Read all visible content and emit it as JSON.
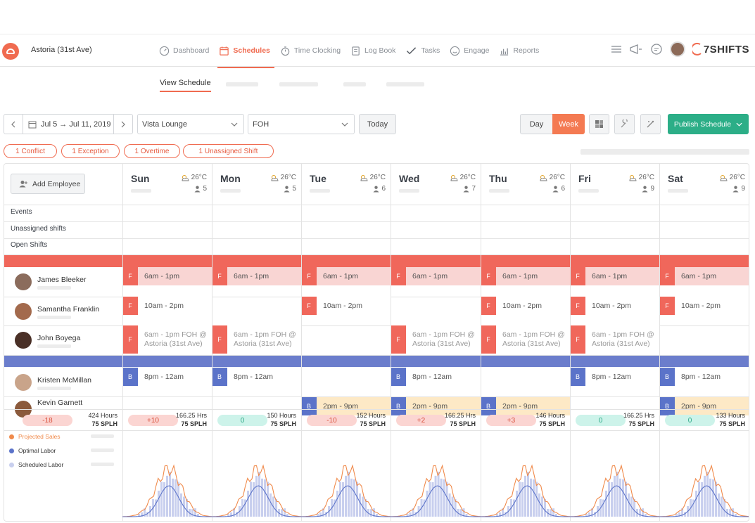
{
  "location": "Astoria (31st Ave)",
  "nav": [
    "Dashboard",
    "Schedules",
    "Time Clocking",
    "Log Book",
    "Tasks",
    "Engage",
    "Reports"
  ],
  "brand": "7SHIFTS",
  "subnav": {
    "view": "View Schedule"
  },
  "toolbar": {
    "date_range": "Jul 5 → Jul 11, 2019",
    "location_select": "Vista Lounge",
    "dept_select": "FOH",
    "today": "Today",
    "day": "Day",
    "week": "Week",
    "publish": "Publish Schedule"
  },
  "badges": [
    "1 Conflict",
    "1 Exception",
    "1 Overtime",
    "1 Unassigned Shift"
  ],
  "add_employee": "Add Employee",
  "days": [
    {
      "name": "Sun",
      "temp": "26°C",
      "count": "5"
    },
    {
      "name": "Mon",
      "temp": "26°C",
      "count": "5"
    },
    {
      "name": "Tue",
      "temp": "26°C",
      "count": "6"
    },
    {
      "name": "Wed",
      "temp": "26°C",
      "count": "7"
    },
    {
      "name": "Thu",
      "temp": "26°C",
      "count": "6"
    },
    {
      "name": "Fri",
      "temp": "26°C",
      "count": "9"
    },
    {
      "name": "Sat",
      "temp": "26°C",
      "count": "9"
    }
  ],
  "row_labels": [
    "Events",
    "Unassigned shifts",
    "Open Shifts"
  ],
  "colors": {
    "foh": "#f0675b",
    "foh_light": "#f9d5d3",
    "boh": "#6b7dcc",
    "boh_tag": "#5b73c9",
    "accent": "#f06b50",
    "green": "#2cae87",
    "open_bg": "#fde9c6"
  },
  "employees": [
    {
      "name": "James Bleeker",
      "shifts": [
        {
          "tag": "F",
          "text": "6am - 1pm"
        },
        {
          "tag": "F",
          "text": "6am - 1pm"
        },
        {
          "tag": "F",
          "text": "6am - 1pm"
        },
        {
          "tag": "F",
          "text": "6am - 1pm"
        },
        {
          "tag": "F",
          "text": "6am - 1pm"
        },
        {
          "tag": "F",
          "text": "6am - 1pm"
        },
        {
          "tag": "F",
          "text": "6am - 1pm"
        }
      ]
    },
    {
      "name": "Samantha Franklin",
      "shifts": [
        {
          "tag": "F",
          "text": "10am - 2pm"
        },
        null,
        {
          "tag": "F",
          "text": "10am - 2pm"
        },
        null,
        {
          "tag": "F",
          "text": "10am - 2pm"
        },
        {
          "tag": "F",
          "text": "10am - 2pm"
        },
        {
          "tag": "F",
          "text": "10am - 2pm"
        }
      ]
    },
    {
      "name": "John Boyega",
      "shifts": [
        {
          "tag": "F",
          "text": "6am - 1pm FOH @ Astoria (31st Ave)"
        },
        {
          "tag": "F",
          "text": "6am - 1pm FOH @ Astoria (31st Ave)"
        },
        null,
        {
          "tag": "F",
          "text": "6am - 1pm FOH @ Astoria (31st Ave)"
        },
        {
          "tag": "F",
          "text": "6am - 1pm FOH @ Astoria (31st Ave)"
        },
        {
          "tag": "F",
          "text": "6am - 1pm FOH @ Astoria (31st Ave)"
        },
        null
      ]
    },
    {
      "name": "Kristen McMillan",
      "shifts": [
        {
          "tag": "B",
          "text": "8pm - 12am"
        },
        {
          "tag": "B",
          "text": "8pm - 12am"
        },
        null,
        {
          "tag": "B",
          "text": "8pm - 12am"
        },
        null,
        {
          "tag": "B",
          "text": "8pm - 12am"
        },
        {
          "tag": "B",
          "text": "8pm - 12am"
        }
      ]
    },
    {
      "name": "Kevin Garnett",
      "shifts": [
        null,
        null,
        {
          "tag": "B",
          "text": "2pm - 9pm"
        },
        {
          "tag": "B",
          "text": "2pm - 9pm"
        },
        {
          "tag": "B",
          "text": "2pm - 9pm"
        },
        null,
        {
          "tag": "B",
          "text": "2pm - 9pm"
        }
      ]
    }
  ],
  "summary": [
    {
      "diff": "-18",
      "hours": "424 Hours",
      "splh": "75 SPLH",
      "tone": "red"
    },
    {
      "diff": "+10",
      "hours": "166.25 Hrs",
      "splh": "75 SPLH",
      "tone": "red"
    },
    {
      "diff": "0",
      "hours": "150 Hours",
      "splh": "75 SPLH",
      "tone": "green"
    },
    {
      "diff": "-10",
      "hours": "152 Hours",
      "splh": "75 SPLH",
      "tone": "red"
    },
    {
      "diff": "+2",
      "hours": "166.25 Hrs",
      "splh": "75 SPLH",
      "tone": "red"
    },
    {
      "diff": "+3",
      "hours": "146 Hours",
      "splh": "75 SPLH",
      "tone": "red"
    },
    {
      "diff": "0",
      "hours": "166.25 Hrs",
      "splh": "75 SPLH",
      "tone": "green"
    },
    {
      "diff": "0",
      "hours": "133 Hours",
      "splh": "75 SPLH",
      "tone": "green"
    }
  ],
  "legend": [
    {
      "label": "Projected Sales",
      "color": "#f08a4b"
    },
    {
      "label": "Optimal Labor",
      "color": "#5b73c9"
    },
    {
      "label": "Scheduled Labor",
      "color": "#c8cfee"
    }
  ]
}
